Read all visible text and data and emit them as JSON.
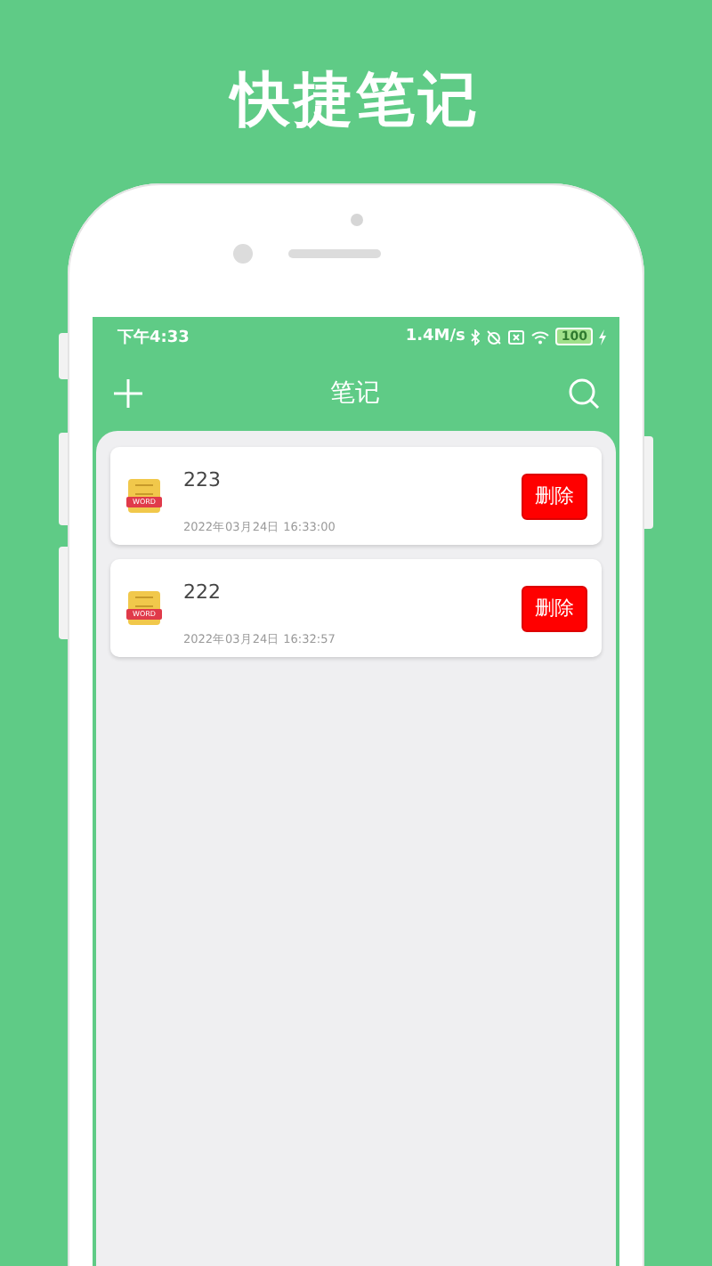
{
  "headline": "快捷笔记",
  "status_bar": {
    "time": "下午4:33",
    "speed": "1.4M/s",
    "battery": "100"
  },
  "app_bar": {
    "title": "笔记"
  },
  "notes": [
    {
      "title": "223",
      "date": "2022年03月24日 16:33:00",
      "file_badge": "WORD",
      "delete_button": "删除"
    },
    {
      "title": "222",
      "date": "2022年03月24日 16:32:57",
      "file_badge": "WORD",
      "delete_button": "删除"
    }
  ]
}
